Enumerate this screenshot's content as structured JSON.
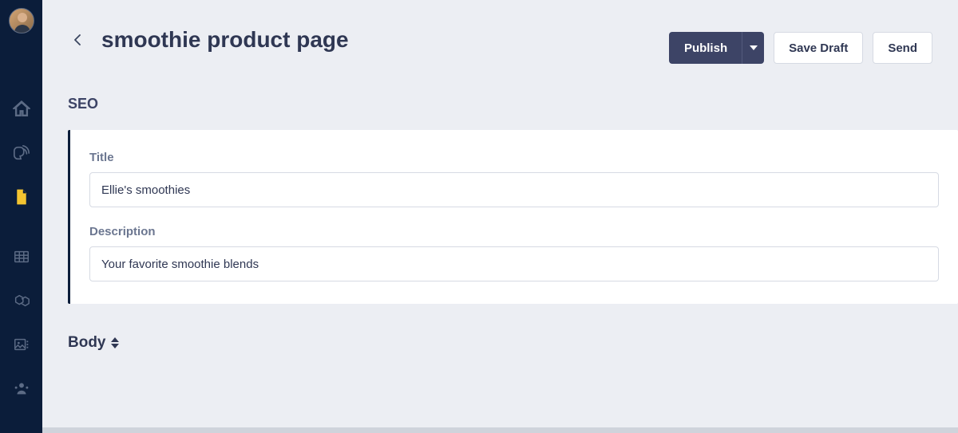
{
  "header": {
    "title": "smoothie product page",
    "actions": {
      "publish": "Publish",
      "save_draft": "Save Draft",
      "send": "Send"
    }
  },
  "sections": {
    "seo": {
      "heading": "SEO",
      "title_label": "Title",
      "title_value": "Ellie's smoothies",
      "description_label": "Description",
      "description_value": "Your favorite smoothie blends"
    },
    "body": {
      "heading": "Body"
    }
  },
  "sidebar": {
    "items": [
      {
        "name": "home-icon"
      },
      {
        "name": "blog-icon"
      },
      {
        "name": "page-icon",
        "active": true
      },
      {
        "name": "table-icon"
      },
      {
        "name": "modules-icon"
      },
      {
        "name": "media-icon"
      },
      {
        "name": "users-icon"
      }
    ]
  }
}
